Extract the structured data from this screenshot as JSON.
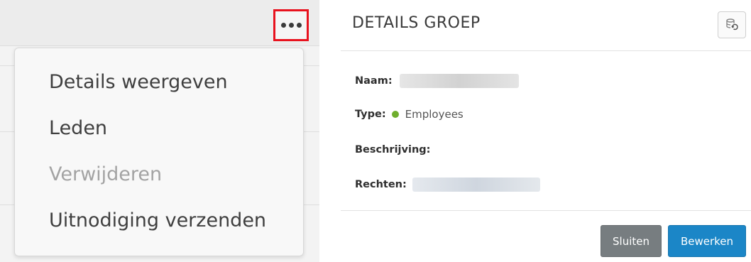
{
  "menu": {
    "items": [
      {
        "label": "Details weergeven",
        "enabled": true
      },
      {
        "label": "Leden",
        "enabled": true
      },
      {
        "label": "Verwijderen",
        "enabled": false
      },
      {
        "label": "Uitnodiging verzenden",
        "enabled": true
      }
    ],
    "trigger_icon": "more-horizontal-icon",
    "highlight_color": "#e8121e"
  },
  "panel": {
    "title": "DETAILS GROEP",
    "refresh_icon": "refresh-database-icon",
    "fields": {
      "name_label": "Naam:",
      "type_label": "Type:",
      "type_value": "Employees",
      "type_color": "#6fae2d",
      "description_label": "Beschrijving:",
      "rights_label": "Rechten:"
    },
    "buttons": {
      "close_label": "Sluiten",
      "edit_label": "Bewerken",
      "edit_color": "#1b86c7",
      "close_color": "#777d80"
    }
  }
}
